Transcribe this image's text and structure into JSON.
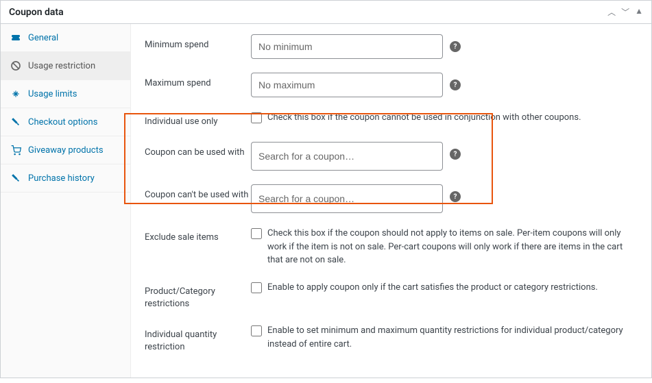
{
  "panel": {
    "title": "Coupon data"
  },
  "sidebar": {
    "items": [
      {
        "label": "General"
      },
      {
        "label": "Usage restriction"
      },
      {
        "label": "Usage limits"
      },
      {
        "label": "Checkout options"
      },
      {
        "label": "Giveaway products"
      },
      {
        "label": "Purchase history"
      }
    ]
  },
  "form": {
    "min_spend": {
      "label": "Minimum spend",
      "placeholder": "No minimum"
    },
    "max_spend": {
      "label": "Maximum spend",
      "placeholder": "No maximum"
    },
    "individual_use": {
      "label": "Individual use only",
      "desc": "Check this box if the coupon cannot be used in conjunction with other coupons."
    },
    "used_with": {
      "label": "Coupon can be used with",
      "placeholder": "Search for a coupon…"
    },
    "not_used_with": {
      "label": "Coupon can't be used with",
      "placeholder": "Search for a coupon…"
    },
    "exclude_sale": {
      "label": "Exclude sale items",
      "desc": "Check this box if the coupon should not apply to items on sale. Per-item coupons will only work if the item is not on sale. Per-cart coupons will only work if there are items in the cart that are not on sale."
    },
    "prod_cat": {
      "label": "Product/Category restrictions",
      "desc": "Enable to apply coupon only if the cart satisfies the product or category restrictions."
    },
    "ind_qty": {
      "label": "Individual quantity restriction",
      "desc": "Enable to set minimum and maximum quantity restrictions for individual product/category instead of entire cart."
    }
  }
}
